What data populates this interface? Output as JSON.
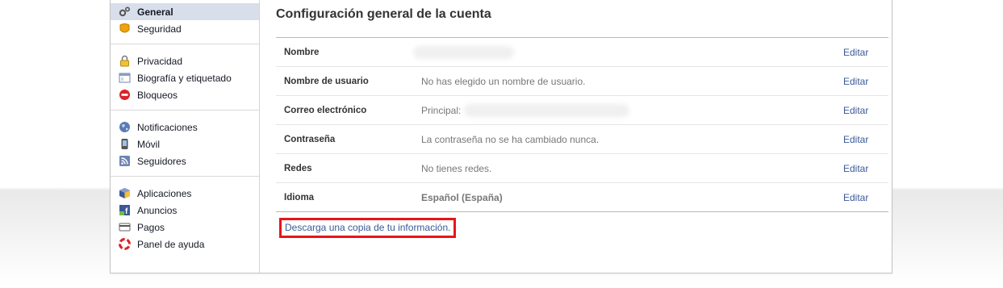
{
  "sidebar": {
    "groups": [
      [
        {
          "label": "General",
          "icon": "gears-icon",
          "active": true
        },
        {
          "label": "Seguridad",
          "icon": "security-badge-icon"
        }
      ],
      [
        {
          "label": "Privacidad",
          "icon": "padlock-icon"
        },
        {
          "label": "Biografía y etiquetado",
          "icon": "timeline-icon"
        },
        {
          "label": "Bloqueos",
          "icon": "block-icon"
        }
      ],
      [
        {
          "label": "Notificaciones",
          "icon": "globe-icon"
        },
        {
          "label": "Móvil",
          "icon": "mobile-icon"
        },
        {
          "label": "Seguidores",
          "icon": "rss-icon"
        }
      ],
      [
        {
          "label": "Aplicaciones",
          "icon": "apps-cube-icon"
        },
        {
          "label": "Anuncios",
          "icon": "ads-icon"
        },
        {
          "label": "Pagos",
          "icon": "credit-card-icon"
        },
        {
          "label": "Panel de ayuda",
          "icon": "lifebuoy-icon"
        }
      ]
    ]
  },
  "main": {
    "title": "Configuración general de la cuenta",
    "rows": [
      {
        "label": "Nombre",
        "value": "",
        "blurred": true,
        "edit": "Editar"
      },
      {
        "label": "Nombre de usuario",
        "value": "No has elegido un nombre de usuario.",
        "edit": "Editar"
      },
      {
        "label": "Correo electrónico",
        "value": "Principal:",
        "blurred": true,
        "edit": "Editar"
      },
      {
        "label": "Contraseña",
        "value": "La contraseña no se ha cambiado nunca.",
        "edit": "Editar"
      },
      {
        "label": "Redes",
        "value": "No tienes redes.",
        "edit": "Editar"
      },
      {
        "label": "Idioma",
        "value": "Español (España)",
        "strong": true,
        "edit": "Editar"
      }
    ],
    "download_link": "Descarga una copia de tu información."
  },
  "colors": {
    "link": "#3b5998",
    "active_bg": "#d8dfea",
    "highlight_box": "#e8151b"
  }
}
